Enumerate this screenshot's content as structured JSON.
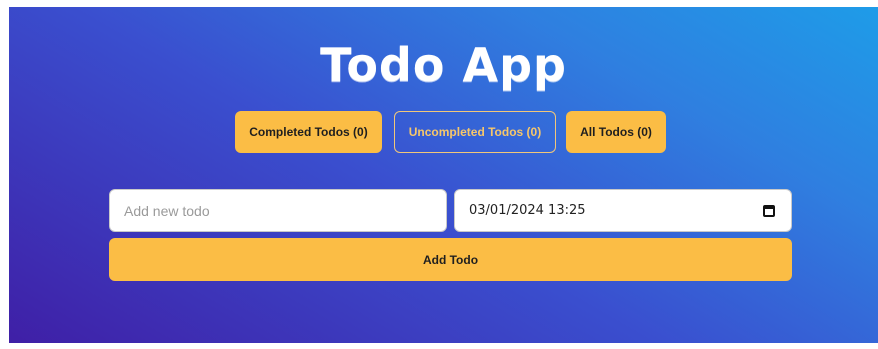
{
  "app": {
    "title": "Todo App"
  },
  "filters": {
    "completed_label": "Completed Todos (0)",
    "uncompleted_label": "Uncompleted Todos (0)",
    "all_label": "All Todos (0)"
  },
  "form": {
    "todo_placeholder": "Add new todo",
    "todo_value": "",
    "datetime_value": "03/01/2024 13:25",
    "add_button_label": "Add Todo"
  },
  "colors": {
    "accent": "#fbbd45",
    "background_start": "#3f1fa6",
    "background_end": "#1e9ce8"
  },
  "icons": {
    "date_picker": "calendar-icon"
  }
}
